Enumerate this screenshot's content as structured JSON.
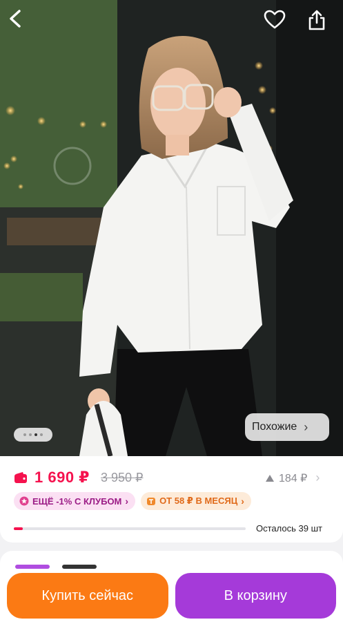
{
  "header": {
    "back_icon": "chevron-left-icon",
    "favorite_icon": "heart-icon",
    "share_icon": "share-icon"
  },
  "gallery": {
    "page_count": 4,
    "active_page": 2,
    "similar_label": "Похожие"
  },
  "product": {
    "price": "1 690 ₽",
    "old_price": "3 950 ₽",
    "rating_value": "184 ₽",
    "club_badge": "ЕЩЁ -1% С КЛУБОМ",
    "installment_badge": "ОТ 58 ₽ В МЕСЯЦ",
    "stock_text": "Осталось 39 шт",
    "stock_fraction": 0.04
  },
  "actions": {
    "buy_now": "Купить сейчас",
    "add_to_cart": "В корзину"
  },
  "colors": {
    "price": "#f5124e",
    "buy_button": "#fb7a14",
    "cart_button": "#a53ad9"
  }
}
